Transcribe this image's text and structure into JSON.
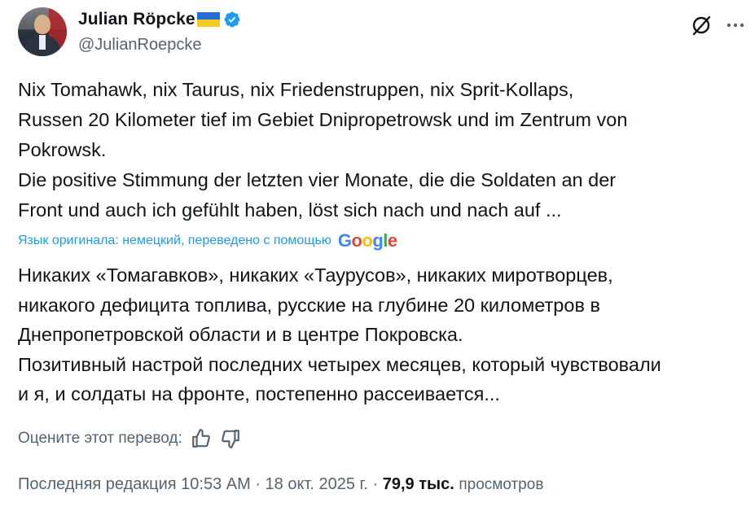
{
  "author": {
    "display_name": "Julian Röpcke",
    "handle": "@JulianRoepcke"
  },
  "icons": {
    "avatar": "profile-photo",
    "flag": "ukraine-flag-icon",
    "verified": "verified-badge-icon",
    "grok": "grok-icon",
    "more": "more-icon",
    "like_translation": "thumbs-up-icon",
    "dislike_translation": "thumbs-down-icon"
  },
  "tweet": {
    "lines": [
      "Nix Tomahawk, nix Taurus, nix Friedenstruppen, nix Sprit-Kollaps,",
      "Russen 20 Kilometer tief im Gebiet Dnipropetrowsk und im Zentrum von",
      "Pokrowsk.",
      "Die positive Stimmung der letzten vier Monate, die die Soldaten an der",
      "Front und auch ich gefühlt haben, löst sich nach und nach auf ..."
    ]
  },
  "translation_notice": {
    "text": "Язык оригинала: немецкий, переведено с помощью",
    "provider_letters": [
      "G",
      "o",
      "o",
      "g",
      "l",
      "e"
    ]
  },
  "translation": {
    "lines": [
      "Никаких «Томагавков», никаких «Таурусов», никаких миротворцев,",
      "никакого дефицита топлива, русские на глубине 20 километров в",
      "Днепропетровской области и в центре Покровска.",
      "Позитивный настрой последних четырех месяцев, который чувствовали",
      "и я, и солдаты на фронте, постепенно рассеивается..."
    ]
  },
  "rate_translation": {
    "label": "Оцените этот перевод:"
  },
  "meta": {
    "edited": "Последняя редакция 10:53 AM · 18 окт. 2025 г. ·",
    "views_count": "79,9 тыс.",
    "views_label": "просмотров"
  },
  "colors": {
    "text": "#0f1419",
    "secondary": "#536471",
    "link": "#1d9bf0",
    "verified": "#1d9bf0"
  }
}
